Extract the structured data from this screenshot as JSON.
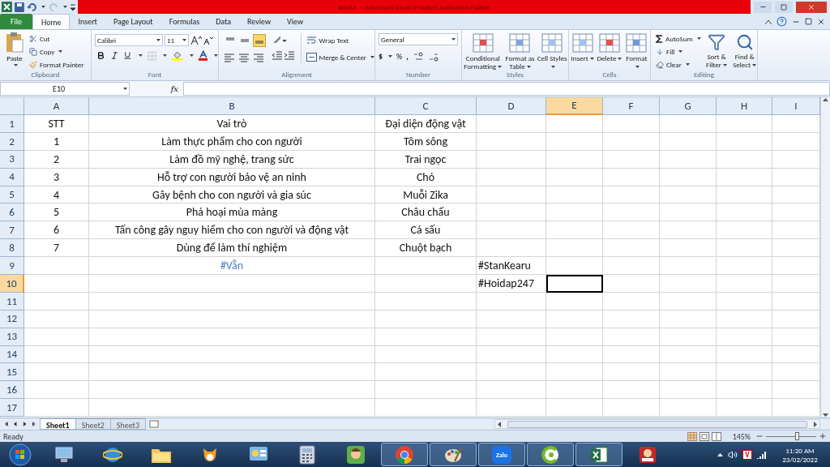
{
  "title_bar": {
    "title": "Book1  -  Microsoft Excel (Product Activation Failed)"
  },
  "tabs": [
    {
      "label": "File",
      "kind": "file",
      "selected": false
    },
    {
      "label": "Home",
      "kind": "tab",
      "selected": true
    },
    {
      "label": "Insert",
      "kind": "tab",
      "selected": false
    },
    {
      "label": "Page Layout",
      "kind": "tab",
      "selected": false
    },
    {
      "label": "Formulas",
      "kind": "tab",
      "selected": false
    },
    {
      "label": "Data",
      "kind": "tab",
      "selected": false
    },
    {
      "label": "Review",
      "kind": "tab",
      "selected": false
    },
    {
      "label": "View",
      "kind": "tab",
      "selected": false
    }
  ],
  "ribbon": {
    "clipboard": {
      "label": "Clipboard",
      "paste": "Paste",
      "cut": "Cut",
      "copy": "Copy",
      "format_painter": "Format Painter"
    },
    "font": {
      "label": "Font",
      "font_name": "Calibri",
      "font_size": "11"
    },
    "alignment": {
      "label": "Alignment",
      "wrap_text": "Wrap Text",
      "merge": "Merge & Center",
      "bottom_align_on": true
    },
    "number": {
      "label": "Number",
      "format": "General",
      "currency": "$",
      "percent": "%",
      "comma": ","
    },
    "styles": {
      "label": "Styles",
      "buttons": [
        "Conditional Formatting",
        "Format as Table",
        "Cell Styles"
      ]
    },
    "cells": {
      "label": "Cells",
      "buttons": [
        "Insert",
        "Delete",
        "Format"
      ]
    },
    "editing": {
      "label": "Editing",
      "autosum": "AutoSum",
      "fill": "Fill",
      "clear": "Clear",
      "buttons": [
        "Sort & Filter",
        "Find & Select"
      ]
    }
  },
  "formula_bar": {
    "name_box": "E10",
    "fx": "fx"
  },
  "sheet": {
    "columns": [
      {
        "letter": "A",
        "selected": false
      },
      {
        "letter": "B",
        "selected": false
      },
      {
        "letter": "C",
        "selected": false
      },
      {
        "letter": "D",
        "selected": false
      },
      {
        "letter": "E",
        "selected": true
      },
      {
        "letter": "F",
        "selected": false
      },
      {
        "letter": "G",
        "selected": false
      },
      {
        "letter": "H",
        "selected": false
      },
      {
        "letter": "I",
        "selected": false
      }
    ],
    "rows": [
      {
        "number": "1",
        "selected": false,
        "cells": {
          "A": "STT",
          "B": "Vai trò",
          "C": "Đại diện động vật"
        }
      },
      {
        "number": "2",
        "selected": false,
        "cells": {
          "A": "1",
          "B": "Làm thực phẩm cho con người",
          "C": "Tôm sông"
        }
      },
      {
        "number": "3",
        "selected": false,
        "cells": {
          "A": "2",
          "B": "Làm đồ mỹ nghệ, trang sức",
          "C": "Trai ngọc"
        }
      },
      {
        "number": "4",
        "selected": false,
        "cells": {
          "A": "3",
          "B": "Hỗ trợ con người bảo vệ an ninh",
          "C": "Chó"
        }
      },
      {
        "number": "5",
        "selected": false,
        "cells": {
          "A": "4",
          "B": "Gây bệnh cho con người và gia súc",
          "C": "Muỗi Zika"
        }
      },
      {
        "number": "6",
        "selected": false,
        "cells": {
          "A": "5",
          "B": "Phá hoại mùa màng",
          "C": "Châu chấu"
        }
      },
      {
        "number": "7",
        "selected": false,
        "cells": {
          "A": "6",
          "B": "Tấn công gây nguy hiểm cho con người và động vật",
          "C": "Cá sấu"
        }
      },
      {
        "number": "8",
        "selected": false,
        "cells": {
          "A": "7",
          "B": "Dùng để làm thí nghiệm",
          "C": "Chuột bạch"
        }
      },
      {
        "number": "9",
        "selected": false,
        "cells": {
          "B": {
            "text": "#Vẵn",
            "color": "#4f81bd"
          },
          "D": "#StanKearu"
        }
      },
      {
        "number": "10",
        "selected": true,
        "cells": {
          "D": "#Hoidap247"
        }
      },
      {
        "number": "11",
        "selected": false,
        "cells": {}
      },
      {
        "number": "12",
        "selected": false,
        "cells": {}
      },
      {
        "number": "13",
        "selected": false,
        "cells": {}
      },
      {
        "number": "14",
        "selected": false,
        "cells": {}
      },
      {
        "number": "15",
        "selected": false,
        "cells": {}
      },
      {
        "number": "16",
        "selected": false,
        "cells": {}
      },
      {
        "number": "17",
        "selected": false,
        "cells": {}
      }
    ]
  },
  "sheet_tabs": [
    {
      "label": "Sheet1",
      "selected": true
    },
    {
      "label": "Sheet2",
      "selected": false
    },
    {
      "label": "Sheet3",
      "selected": false
    }
  ],
  "status_bar": {
    "status": "Ready",
    "zoom": "145%",
    "zoom_slider": {
      "level": 0.62
    }
  },
  "taskbar": {
    "items": [
      {
        "kind": "start",
        "active": false
      },
      {
        "kind": "monitor",
        "active": false
      },
      {
        "kind": "browser",
        "active": false
      },
      {
        "kind": "folder",
        "active": false
      },
      {
        "kind": "cat",
        "active": false
      },
      {
        "kind": "panel",
        "active": false
      },
      {
        "kind": "calculator",
        "active": false
      },
      {
        "kind": "character",
        "active": false
      },
      {
        "kind": "chrome",
        "active": true
      },
      {
        "kind": "paint",
        "active": true
      },
      {
        "kind": "zalo",
        "active": true,
        "label": "Zalo"
      },
      {
        "kind": "coccoc",
        "active": true
      },
      {
        "kind": "excel",
        "active": true
      },
      {
        "kind": "book",
        "active": false
      }
    ],
    "input_method": "V",
    "time": "11:20 AM",
    "date": "23/02/2022"
  }
}
